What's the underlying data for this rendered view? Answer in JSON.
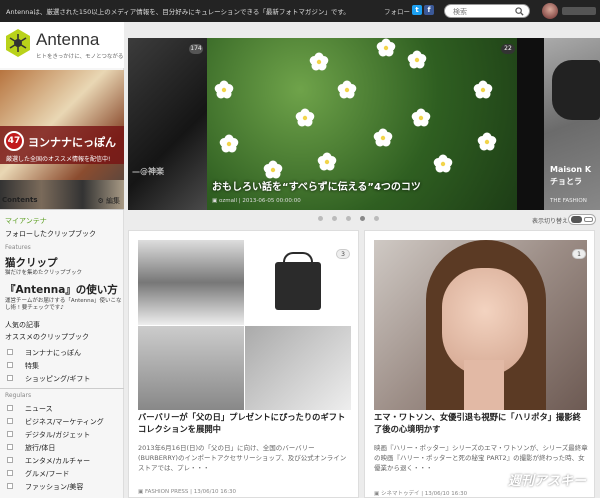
{
  "topbar": {
    "message": "Antennaは、厳選された150以上のメディア情報を、目分好みにキュレーションできる「最新フォトマガジン」です。",
    "follow_label": "フォロー",
    "search_placeholder": "検索"
  },
  "logo": {
    "word": "Antenna",
    "tagline": "ヒトをきっかけに、モノとつながる"
  },
  "banner": {
    "badge": "47",
    "title": "ヨンナナにっぽん",
    "subtitle": "厳選した全国のオススメ情報を配信中!"
  },
  "sidebar": {
    "contents_label": "Contents",
    "edit_label": "編集",
    "my_antenna": "マイアンテナ",
    "followed": "フォローしたクリップブック",
    "features_heading": "Features",
    "nekoclip_title": "猫クリップ",
    "nekoclip_sub": "猫だけを集めたクリップブック",
    "howto_title": "『Antenna』の使い方",
    "howto_sub1": "運営チームがお届けする「Antenna」使いこな",
    "howto_sub2": "し術 ! 要チェックです♪",
    "popular": "人気の記事",
    "recommended": "オススメのクリップブック",
    "features_items": [
      "ヨンナナにっぽん",
      "特集",
      "ショッピング/ギフト"
    ],
    "regulars_heading": "Regulars",
    "regulars_items": [
      "ニュース",
      "ビジネス/マーケティング",
      "デジタル/ガジェット",
      "旅行/体日",
      "エンタメ/カルチャー",
      "グルメ/フード",
      "ファッション/美容"
    ]
  },
  "hero": {
    "left_count": "174",
    "left_caption": "—@神楽",
    "main_count": "22",
    "main_title": "おもしろい話を“すべらずに伝える”4つのコツ",
    "main_source": "ozmall",
    "main_date": "2013-06-05 00:00:00",
    "right_caption_1": "Maison K",
    "right_caption_2": "チョとラ",
    "right_source": "THE FASHION"
  },
  "view_toggle_label": "表示切り替え",
  "cards": [
    {
      "count": "3",
      "title": "バーバリーが「父の日」プレゼントにぴったりのギフトコレクションを展開中",
      "description": "2013年6月16日(日)の「父の日」に向け、全国のバーバリー(BURBERRY)のインポートアクセサリーショップ、及び公式オンラインストアでは、プレ・・・",
      "source": "FASHION PRESS | 13/06/10 16:30"
    },
    {
      "count": "1",
      "title": "エマ・ワトソン、女優引退も視野に「ハリポタ」撮影終了後の心境明かす",
      "description": "映画『ハリー・ポッター』シリーズのエマ・ワトソンが、シリーズ最終章の映画『ハリー・ポッターと死の秘宝 PART2』の撮影が終わった時、女優業から退く・・・",
      "source": "シネマトゥデイ | 13/06/10 16:30"
    }
  ],
  "watermark": "週刊アスキー",
  "colors": {
    "accent": "#5a9e1f",
    "topbar": "#232323",
    "twitter": "#1da1f2",
    "facebook": "#3b5998"
  }
}
